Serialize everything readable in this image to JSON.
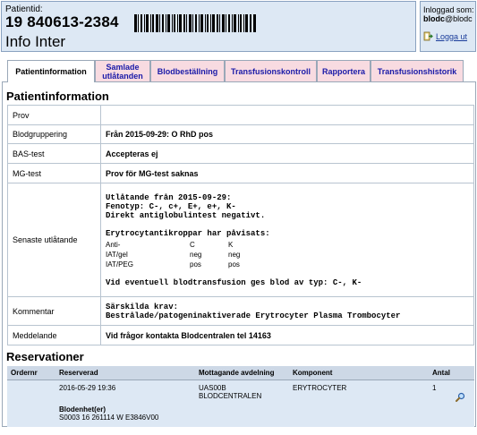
{
  "header": {
    "patient_label": "Patientid:",
    "patient_id": "19 840613-2384",
    "patient_name": "Info Inter",
    "logged_in_label": "Inloggad som:",
    "user_bold": "blodc",
    "user_rest": "@blodc",
    "logout_label": "Logga ut"
  },
  "tabs": [
    {
      "label": "Patientinformation",
      "active": true
    },
    {
      "label": "Samlade utlåtanden",
      "active": false
    },
    {
      "label": "Blodbeställning",
      "active": false
    },
    {
      "label": "Transfusionskontroll",
      "active": false
    },
    {
      "label": "Rapportera",
      "active": false
    },
    {
      "label": "Transfusionshistorik",
      "active": false
    }
  ],
  "patientinfo": {
    "title": "Patientinformation",
    "rows": {
      "prov": {
        "label": "Prov",
        "value": ""
      },
      "blood": {
        "label": "Blodgruppering",
        "value": "Från 2015-09-29: O RhD pos"
      },
      "bas": {
        "label": "BAS-test",
        "value": "Accepteras ej"
      },
      "mg": {
        "label": "MG-test",
        "value": "Prov för MG-test saknas"
      },
      "senaste": {
        "label": "Senaste utlåtande",
        "line1": "Utlåtande från 2015-09-29:",
        "line2": "Fenotyp: C-, c+, E+, e+, K-",
        "line3": "Direkt antiglobulintest negativt.",
        "line4": "Erytrocytantikroppar har påvisats:",
        "ab_table": [
          [
            "Anti-",
            "C",
            "K"
          ],
          [
            "IAT/gel",
            "neg",
            "neg"
          ],
          [
            "IAT/PEG",
            "pos",
            "pos"
          ]
        ],
        "line5": "Vid eventuell blodtransfusion ges blod av typ: C-, K-"
      },
      "kommentar": {
        "label": "Kommentar",
        "line1": "Särskilda krav:",
        "line2": "Bestrålade/patogeninaktiverade Erytrocyter Plasma Trombocyter"
      },
      "meddelande": {
        "label": "Meddelande",
        "value": "Vid frågor kontakta Blodcentralen tel 14163"
      }
    }
  },
  "reservations": {
    "title": "Reservationer",
    "columns": [
      "Ordernr",
      "Reserverad",
      "Mottagande avdelning",
      "Komponent",
      "Antal"
    ],
    "row": {
      "ordernr": "",
      "reserverad": "2016-05-29 19:36",
      "avdelning_line1": "UAS00B",
      "avdelning_line2": "BLODCENTRALEN",
      "komponent": "ERYTROCYTER",
      "antal": "1",
      "blodenhet_label": "Blodenhet(er)",
      "blodenhet_value": "S0003 16 261114 W E3846V00"
    }
  },
  "icons": {
    "barcode": "barcode-icon",
    "logout": "logout-icon",
    "zoom": "magnifier-icon"
  },
  "colors": {
    "header_bg": "#dde8f4",
    "tab_bg": "#f8dbe1",
    "tab_text": "#1a1aa8",
    "table_header_bg": "#cdd8e6",
    "border": "#9aa8b8"
  }
}
